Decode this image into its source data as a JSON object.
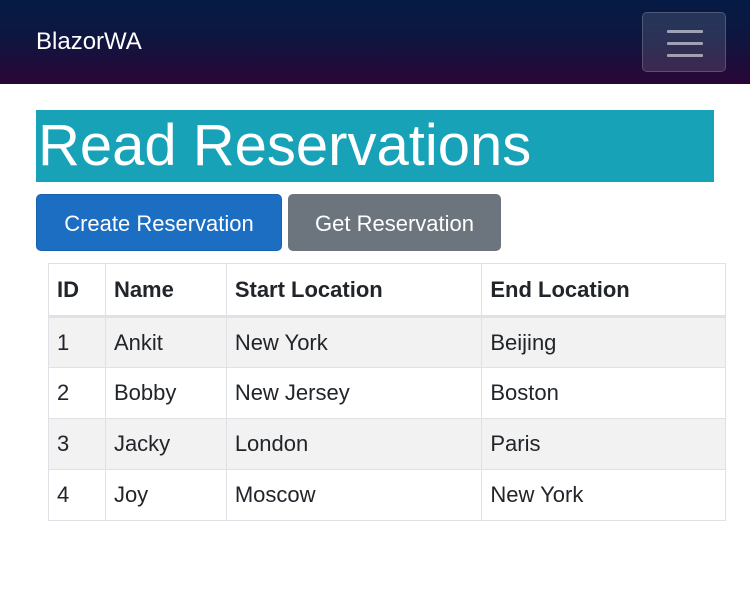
{
  "navbar": {
    "brand": "BlazorWA",
    "toggler_icon": "hamburger-menu-icon"
  },
  "page": {
    "title": "Read Reservations"
  },
  "actions": {
    "create_label": "Create Reservation",
    "get_label": "Get Reservation"
  },
  "colors": {
    "navbar_gradient_top": "#051b45",
    "navbar_gradient_bottom": "#2a0636",
    "title_bg": "#17a2b8",
    "primary": "#1b6ec2",
    "secondary": "#6c757d",
    "stripe": "#f2f2f2"
  },
  "table": {
    "headers": [
      "ID",
      "Name",
      "Start Location",
      "End Location"
    ],
    "rows": [
      [
        "1",
        "Ankit",
        "New York",
        "Beijing"
      ],
      [
        "2",
        "Bobby",
        "New Jersey",
        "Boston"
      ],
      [
        "3",
        "Jacky",
        "London",
        "Paris"
      ],
      [
        "4",
        "Joy",
        "Moscow",
        "New York"
      ]
    ]
  }
}
